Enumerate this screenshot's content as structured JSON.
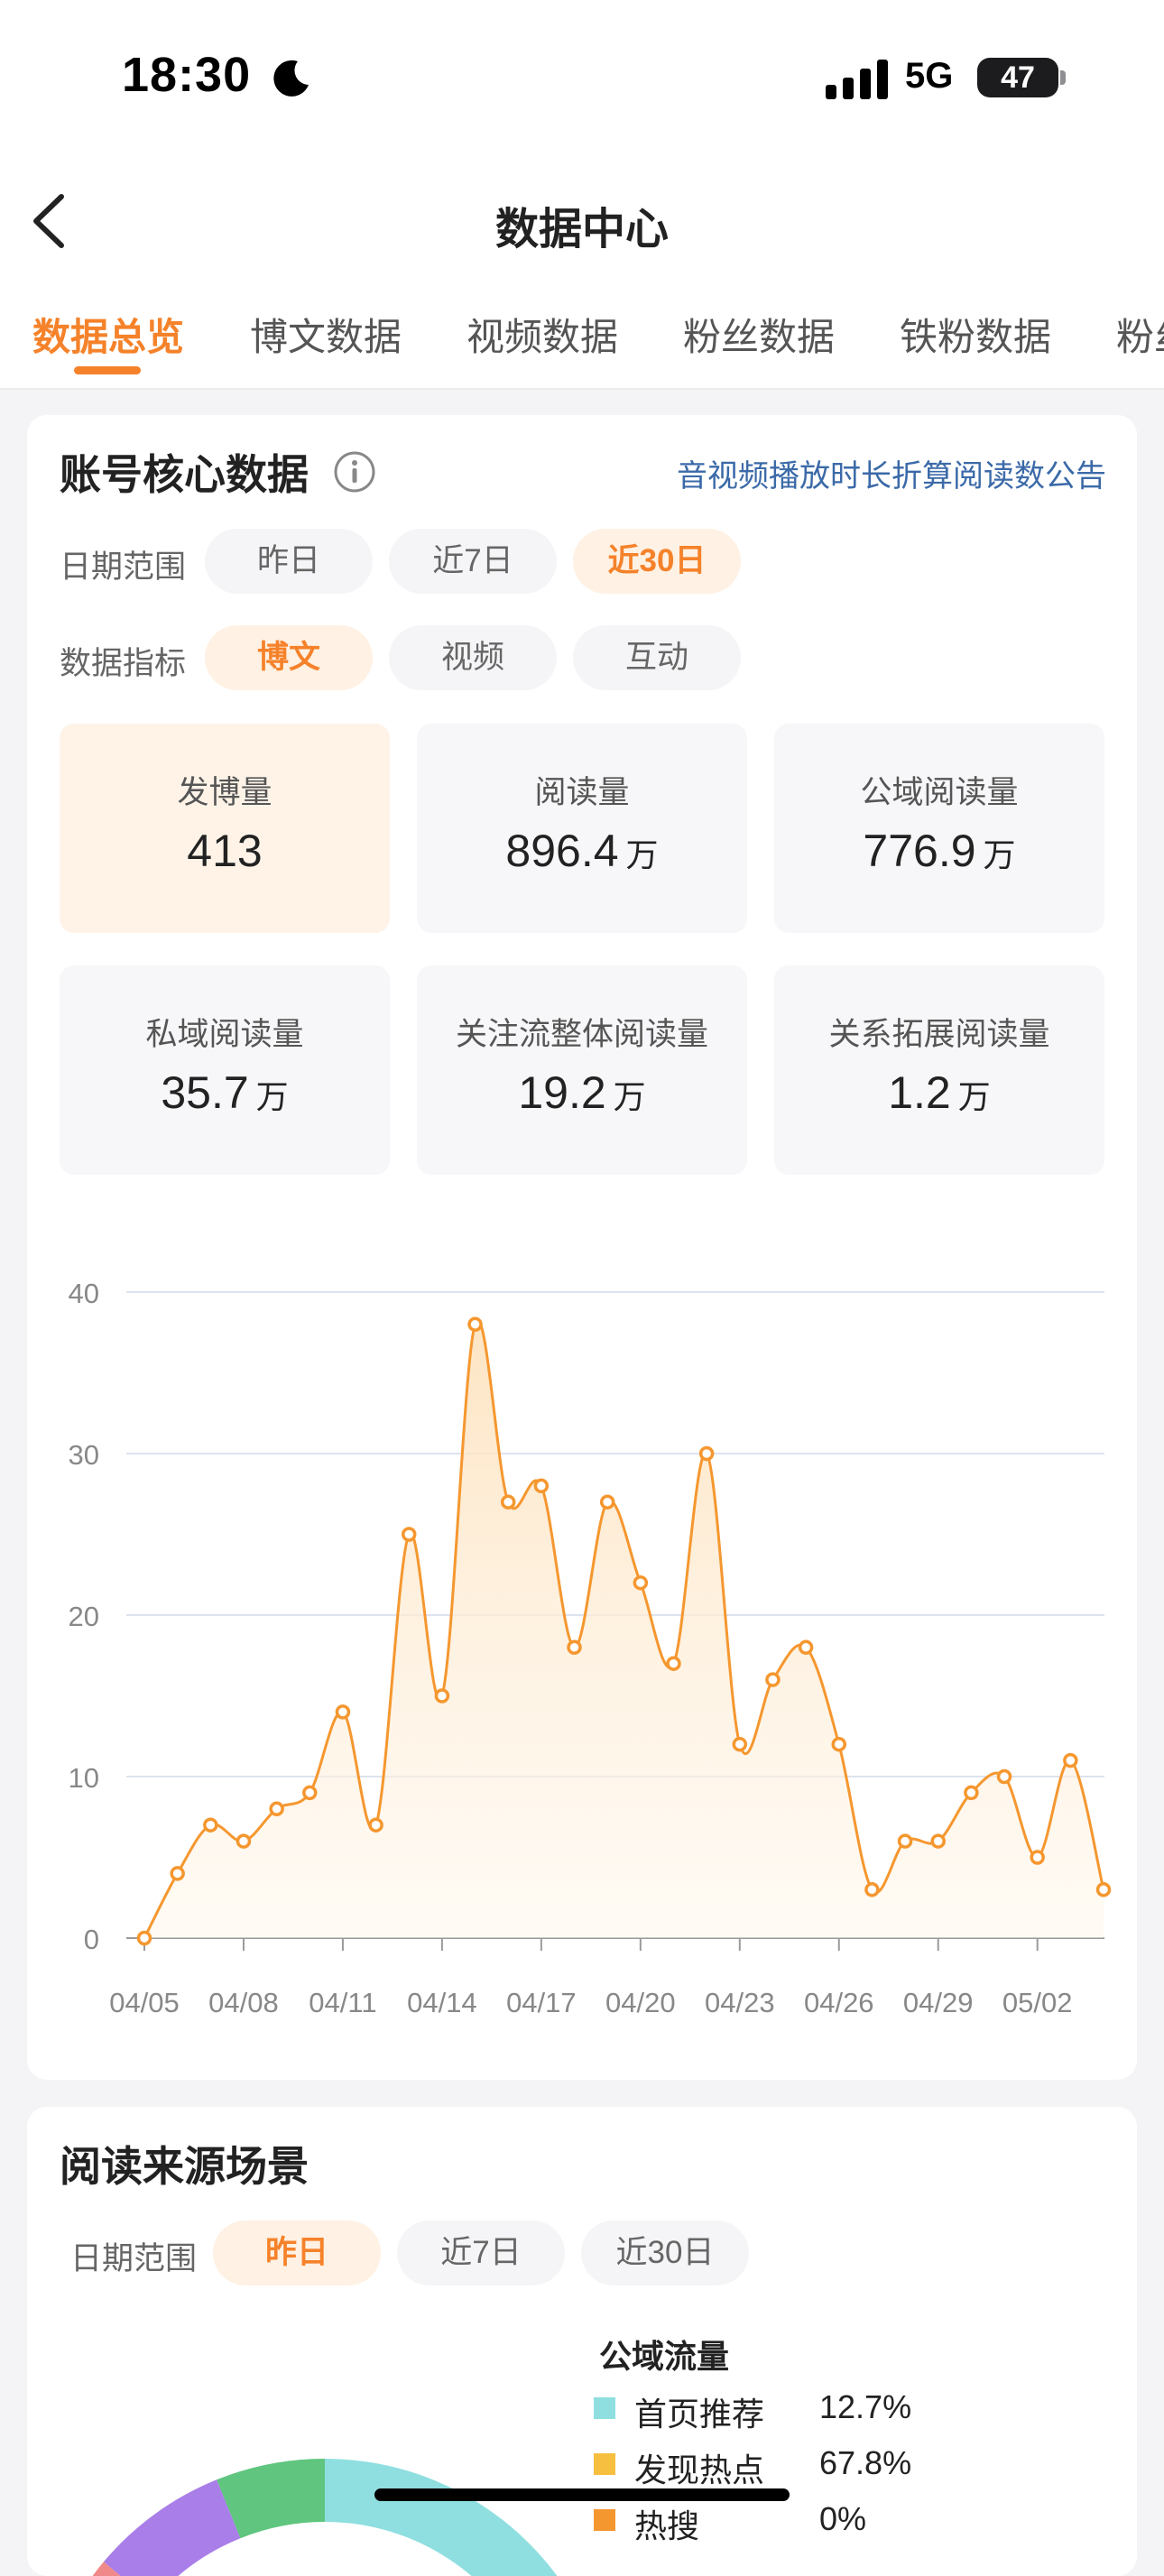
{
  "status_bar": {
    "time": "18:30",
    "network": "5G",
    "battery": "47"
  },
  "nav": {
    "title": "数据中心"
  },
  "tabs": [
    {
      "label": "数据总览",
      "active": true
    },
    {
      "label": "博文数据"
    },
    {
      "label": "视频数据"
    },
    {
      "label": "粉丝数据"
    },
    {
      "label": "铁粉数据"
    },
    {
      "label": "粉丝"
    }
  ],
  "core": {
    "title": "账号核心数据",
    "notice": "音视频播放时长折算阅读数公告",
    "date_label": "日期范围",
    "date_options": [
      "昨日",
      "近7日",
      "近30日"
    ],
    "date_selected": "近30日",
    "metric_label": "数据指标",
    "metric_options": [
      "博文",
      "视频",
      "互动"
    ],
    "metric_selected": "博文",
    "metrics": [
      {
        "label": "发博量",
        "value": "413",
        "unit": ""
      },
      {
        "label": "阅读量",
        "value": "896.4",
        "unit": "万"
      },
      {
        "label": "公域阅读量",
        "value": "776.9",
        "unit": "万"
      },
      {
        "label": "私域阅读量",
        "value": "35.7",
        "unit": "万"
      },
      {
        "label": "关注流整体阅读量",
        "value": "19.2",
        "unit": "万"
      },
      {
        "label": "关系拓展阅读量",
        "value": "1.2",
        "unit": "万"
      }
    ]
  },
  "chart_data": {
    "type": "area",
    "x": [
      "04/05",
      "04/06",
      "04/07",
      "04/08",
      "04/09",
      "04/10",
      "04/11",
      "04/12",
      "04/13",
      "04/14",
      "04/15",
      "04/16",
      "04/17",
      "04/18",
      "04/19",
      "04/20",
      "04/21",
      "04/22",
      "04/23",
      "04/24",
      "04/25",
      "04/26",
      "04/27",
      "04/28",
      "04/29",
      "04/30",
      "05/01",
      "05/02",
      "05/03",
      "05/04"
    ],
    "tick_labels": [
      "04/05",
      "04/08",
      "04/11",
      "04/14",
      "04/17",
      "04/20",
      "04/23",
      "04/26",
      "04/29",
      "05/02"
    ],
    "values": [
      0,
      4,
      7,
      6,
      8,
      9,
      14,
      7,
      25,
      15,
      38,
      27,
      28,
      18,
      27,
      22,
      17,
      30,
      12,
      16,
      18,
      12,
      3,
      6,
      6,
      9,
      10,
      5,
      11,
      3
    ],
    "ylim": [
      0,
      40
    ],
    "yticks": [
      0,
      10,
      20,
      30,
      40
    ],
    "grid": true,
    "color": "#f5972f"
  },
  "source": {
    "title": "阅读来源场景",
    "date_label": "日期范围",
    "date_options": [
      "昨日",
      "近7日",
      "近30日"
    ],
    "date_selected": "昨日",
    "legend_title": "公域流量",
    "legend": [
      {
        "name": "首页推荐",
        "pct": "12.7%",
        "color": "#8fdfe0"
      },
      {
        "name": "发现热点",
        "pct": "67.8%",
        "color": "#f7bf3f"
      },
      {
        "name": "热搜",
        "pct": "0%",
        "color": "#f5972f"
      }
    ]
  }
}
